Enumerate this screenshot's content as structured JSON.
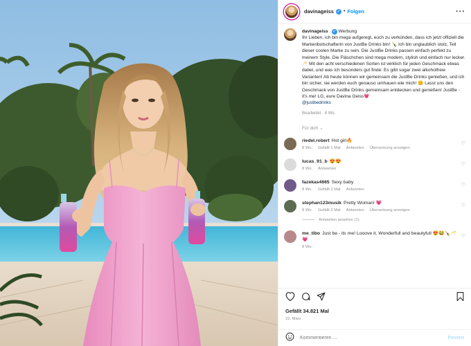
{
  "author": {
    "username": "davinageiss",
    "follow_label": "Folgen",
    "separator": "•",
    "partnership": "Werbung"
  },
  "caption": {
    "text": "Ihr Lieben, ich bin mega aufgeregt, euch zu verkünden, dass ich jetzt offiziell die Markenbotschafterin von JustBe Drinks bin! 🍾 Ich bin unglaublich stolz, Teil dieser coolen Marke zu sein. Die JustBe Drinks passen einfach perfekt zu meinem Style. Die Fläschchen sind mega modern, stylish und einfach nur lecker. 🥂 Mit den acht verschiedenen Sorten ist wirklich für jeden Geschmack etwas dabei, und was ich besonders gut finde: Es gibt sogar zwei alkoholfreie Varianten! Ab heute können wir gemeinsam die JustBe Drinks genießen, und ich bin sicher, sie werden euch genauso umhauen wie mich! 😊 Lasst uns den Geschmack von JustBe Drinks gemeinsam entdecken und genießen! JustBe - it's me! LG, eure Davina Geiss💗",
    "mention": "@justbedrinks",
    "edited": "Bearbeitet",
    "age": "8 Wo.",
    "translate": "Für dich ⌄"
  },
  "comments": [
    {
      "user": "riedel.robert",
      "text": "Hot girl🔥",
      "age": "8 Wo.",
      "likes": "Gefällt 1 Mal",
      "reply": "Antworten",
      "translate": "Übersetzung anzeigen",
      "color": "#7a6a55"
    },
    {
      "user": "lucas_91_b",
      "text": "😍😍",
      "age": "8 Wo.",
      "likes": "",
      "reply": "Antworten",
      "translate": "",
      "color": "#dbdbdb"
    },
    {
      "user": "fazekas4665",
      "text": "Sexy baby",
      "age": "8 Wo.",
      "likes": "Gefällt 2 Mal",
      "reply": "Antworten",
      "translate": "",
      "color": "#6f5a8a"
    },
    {
      "user": "stephan123musik",
      "text": "Pretty Woman! 💗",
      "age": "8 Wo.",
      "likes": "Gefällt 2 Mal",
      "reply": "Antworten",
      "translate": "Übersetzung anzeigen",
      "color": "#5d6b52"
    },
    {
      "user": "me_tibo",
      "text": "Just be - its me! Looove it. Wonderfull and beautyfull 😍😂🍾🥂💗",
      "age": "8 Wo.",
      "likes": "",
      "reply": "",
      "translate": "",
      "color": "#b7898a"
    }
  ],
  "replies_label": "Antworten ansehen (1)",
  "likes_text": "Gefällt 34.821 Mal",
  "post_date": "22. März",
  "comment_box": {
    "placeholder": "Kommentieren ...",
    "post_label": "Posten"
  },
  "icons": [
    "heart-icon",
    "comment-icon",
    "share-icon",
    "bookmark-icon",
    "emoji-icon",
    "more-icon",
    "verified-icon"
  ],
  "colors": {
    "accent": "#0095f6",
    "muted": "#8e8e8e",
    "text": "#262626",
    "dress": "#f2a9cf"
  }
}
